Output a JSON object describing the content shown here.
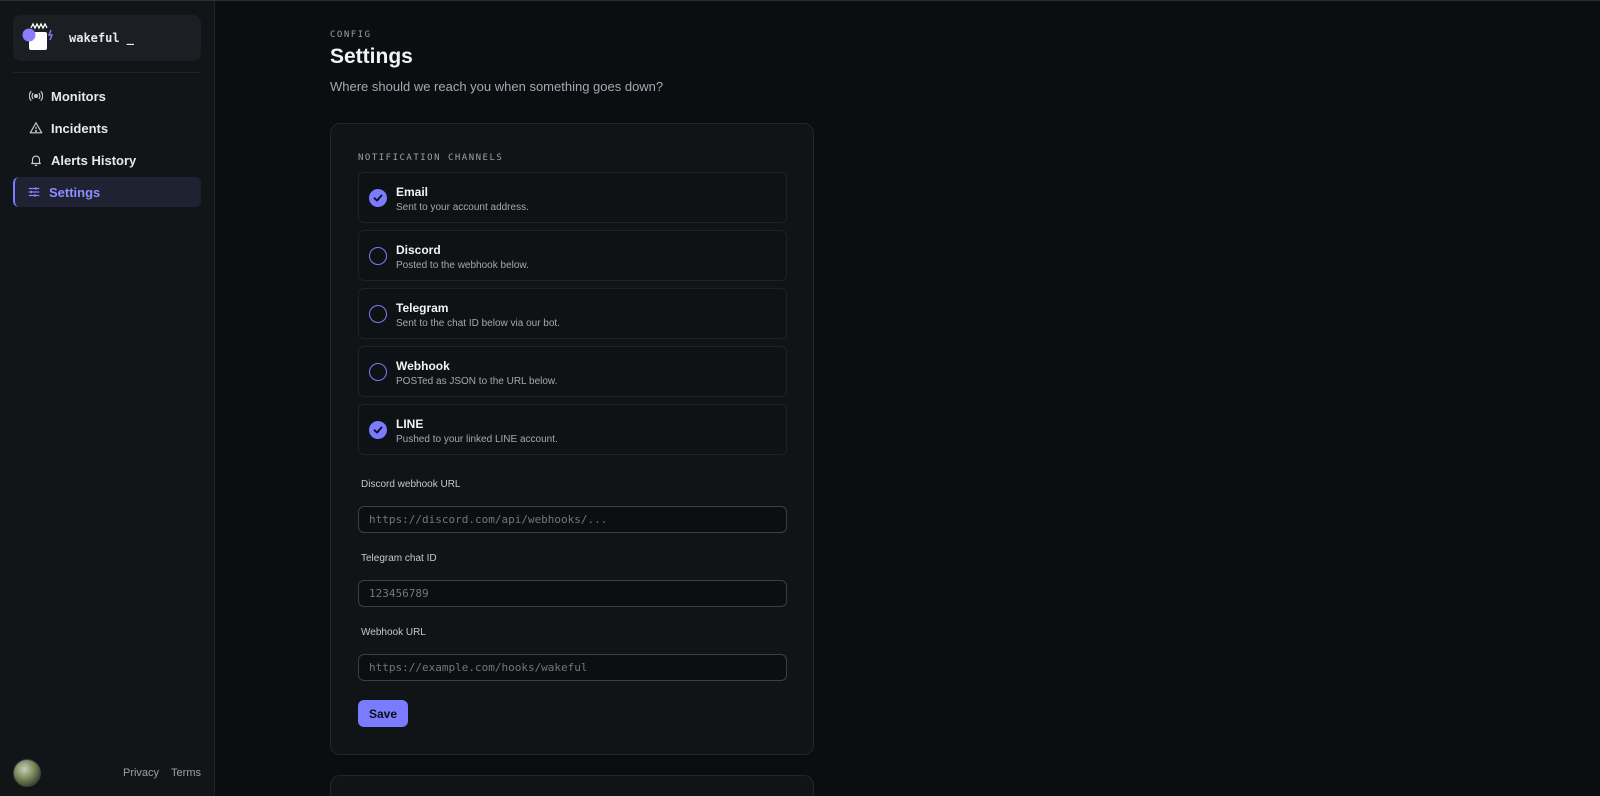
{
  "brand": {
    "name": "wakeful _"
  },
  "nav": {
    "items": [
      {
        "label": "Monitors",
        "icon": "broadcast-icon"
      },
      {
        "label": "Incidents",
        "icon": "warning-triangle-icon"
      },
      {
        "label": "Alerts History",
        "icon": "bell-icon"
      },
      {
        "label": "Settings",
        "icon": "sliders-icon",
        "active": true
      }
    ]
  },
  "footer": {
    "privacy": "Privacy",
    "terms": "Terms"
  },
  "header": {
    "eyebrow": "CONFIG",
    "title": "Settings",
    "subtitle": "Where should we reach you when something goes down?"
  },
  "notifications": {
    "section_label": "NOTIFICATION CHANNELS",
    "channels": [
      {
        "name": "Email",
        "description": "Sent to your account address.",
        "checked": true
      },
      {
        "name": "Discord",
        "description": "Posted to the webhook below.",
        "checked": false
      },
      {
        "name": "Telegram",
        "description": "Sent to the chat ID below via our bot.",
        "checked": false
      },
      {
        "name": "Webhook",
        "description": "POSTed as JSON to the URL below.",
        "checked": false
      },
      {
        "name": "LINE",
        "description": "Pushed to your linked LINE account.",
        "checked": true
      }
    ],
    "fields": {
      "discord": {
        "label": "Discord webhook URL",
        "placeholder": "https://discord.com/api/webhooks/..."
      },
      "telegram": {
        "label": "Telegram chat ID",
        "placeholder": "123456789"
      },
      "webhook": {
        "label": "Webhook URL",
        "placeholder": "https://example.com/hooks/wakeful"
      }
    },
    "save_label": "Save"
  },
  "colors": {
    "accent": "#7b7bff",
    "background": "#0b0d10",
    "sidebar": "#121518",
    "card": "#111417"
  }
}
